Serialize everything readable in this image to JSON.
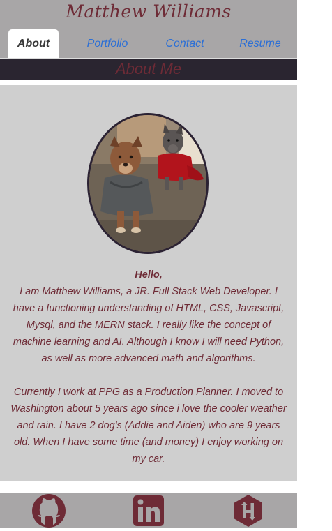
{
  "header": {
    "title": "Matthew Williams"
  },
  "nav": {
    "tabs": [
      {
        "label": "About",
        "active": true
      },
      {
        "label": "Portfolio",
        "active": false
      },
      {
        "label": "Contact",
        "active": false
      },
      {
        "label": "Resume",
        "active": false
      }
    ]
  },
  "section": {
    "heading": "About Me"
  },
  "about": {
    "greeting": "Hello,",
    "paragraph1": "I am Matthew Williams, a JR. Full Stack Web Developer. I have a functioning understanding of HTML, CSS, Javascript, Mysql, and the MERN stack. I really like the concept of machine learning and AI. Although I know I will need Python, as well as more advanced math and algorithms.",
    "paragraph2": "Currently I work at PPG as a Production Planner. I moved to Washington about 5 years ago since i love the cooler weather and rain. I have 2 dog's (Addie and Aiden) who are 9 years old. When I have some time (and money) I enjoy working on my car."
  },
  "footer": {
    "icons": [
      "github-icon",
      "linkedin-icon",
      "hackerrank-icon"
    ]
  },
  "colors": {
    "brand": "#6e2b36",
    "header_bg": "#a8a6a7",
    "section_bar": "#2a2530",
    "content_bg": "#cfcfcf",
    "nav_link": "#2b6fd6"
  }
}
